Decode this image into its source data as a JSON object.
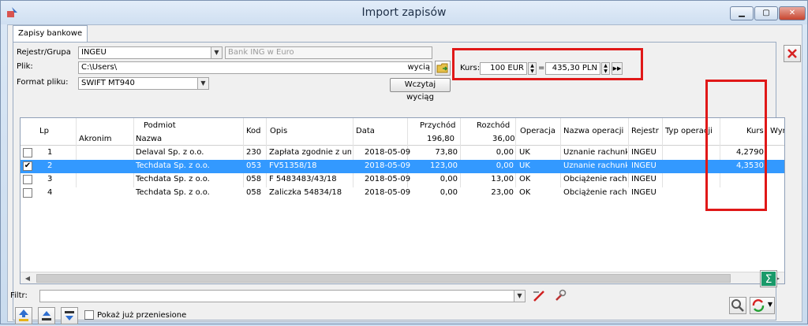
{
  "window": {
    "title": "Import zapisów",
    "min": "▁",
    "max": "▢",
    "close": "✕"
  },
  "tab": {
    "label": "Zapisy bankowe"
  },
  "form": {
    "rejestr_label": "Rejestr/Grupa",
    "rejestr_value": "INGEU",
    "rejestr_desc": "Bank ING w Euro",
    "plik_label": "Plik:",
    "plik_value": "C:\\Users\\",
    "plik_suffix": "wycią",
    "format_label": "Format pliku:",
    "format_value": "SWIFT MT940",
    "wczytaj_label": "Wczytaj wyciąg",
    "kurs_label": "Kurs:",
    "kurs_from": "100 EUR",
    "kurs_eq": "=",
    "kurs_to": "435,30 PLN",
    "kurs_next": "▶▶"
  },
  "table": {
    "headers": {
      "lp": "Lp",
      "podmiot": "Podmiot",
      "akronim": "Akronim",
      "nazwa": "Nazwa",
      "kod": "Kod",
      "opis": "Opis",
      "data": "Data",
      "przychod": "Przychód",
      "przychod_total": "196,80",
      "rozchod": "Rozchód",
      "rozchod_total": "36,00",
      "operacja": "Operacja",
      "nazwa_operacji": "Nazwa operacji",
      "rejestr": "Rejestr",
      "typ_operacji": "Typ operacji",
      "kurs": "Kurs",
      "wynik": "Wynik"
    },
    "rows": [
      {
        "checked": "",
        "lp": "1",
        "nazwa": "Delaval Sp. z o.o.",
        "kod": "230",
        "opis": "Zapłata zgodnie z umow",
        "data": "2018-05-09",
        "przychod": "73,80",
        "rozchod": "0,00",
        "operacja": "UK",
        "nazwa_operacji": "Uznanie rachunku",
        "rejestr": "INGEU",
        "typ": "",
        "kurs": "4,2790"
      },
      {
        "checked": "✔",
        "lp": "2",
        "nazwa": "Techdata Sp. z o.o.",
        "kod": "053",
        "opis": "FV51358/18",
        "data": "2018-05-09",
        "przychod": "123,00",
        "rozchod": "0,00",
        "operacja": "UK",
        "nazwa_operacji": "Uznanie rachunku",
        "rejestr": "INGEU",
        "typ": "",
        "kurs": "4,3530"
      },
      {
        "checked": "",
        "lp": "3",
        "nazwa": "Techdata Sp. z o.o.",
        "kod": "058",
        "opis": "F 5483483/43/18",
        "data": "2018-05-09",
        "przychod": "0,00",
        "rozchod": "13,00",
        "operacja": "OK",
        "nazwa_operacji": "Obciążenie rachunk",
        "rejestr": "INGEU",
        "typ": "",
        "kurs": ""
      },
      {
        "checked": "",
        "lp": "4",
        "nazwa": "Techdata Sp. z o.o.",
        "kod": "058",
        "opis": "Zaliczka 54834/18",
        "data": "2018-05-09",
        "przychod": "0,00",
        "rozchod": "23,00",
        "operacja": "OK",
        "nazwa_operacji": "Obciążenie rachunk",
        "rejestr": "INGEU",
        "typ": "",
        "kurs": ""
      }
    ]
  },
  "filter": {
    "label": "Filtr:",
    "value": ""
  },
  "bottom": {
    "pokaz_label": "Pokaż już przeniesione"
  },
  "colors": {
    "selection": "#3399ff",
    "highlight": "#e01818"
  }
}
